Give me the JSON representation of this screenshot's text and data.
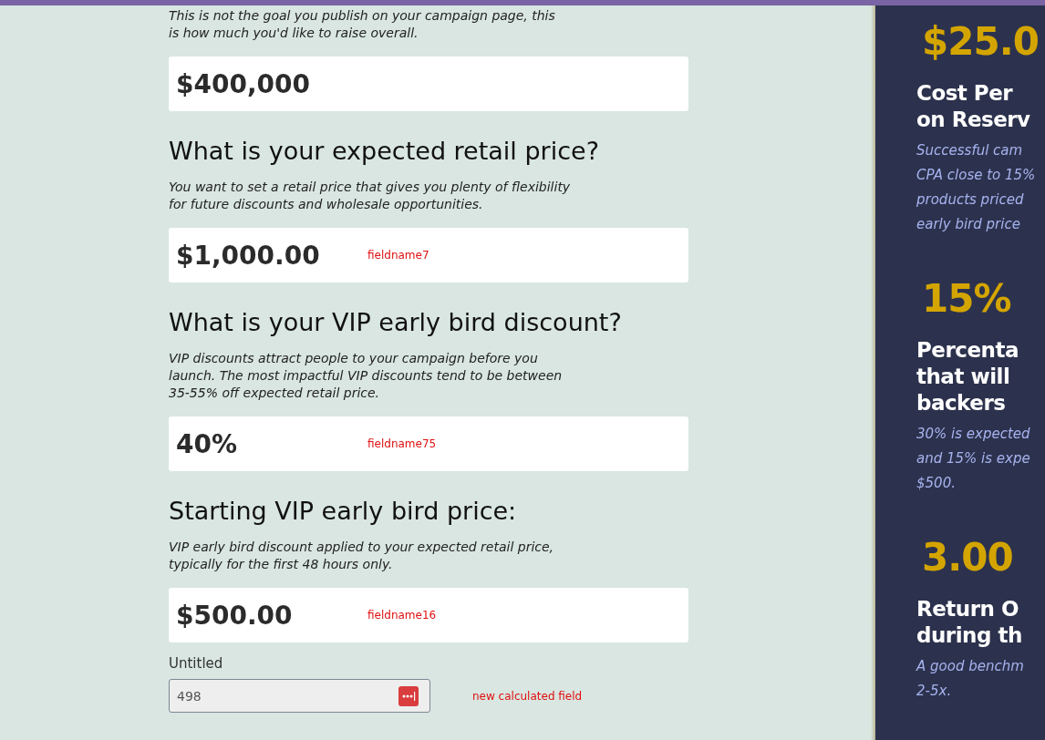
{
  "sections": [
    {
      "description": "This is not the goal you publish on your campaign page, this\nis how much you'd like to raise overall.",
      "value": "$400,000"
    },
    {
      "heading": "What is your expected retail price?",
      "description": "You want to set a retail price that gives you plenty of flexibility\nfor future discounts and wholesale opportunities.",
      "value": "$1,000.00",
      "field_tag": "fieldname7"
    },
    {
      "heading": "What is your VIP early bird discount?",
      "description": "VIP discounts attract people to your campaign before you\nlaunch. The most impactful VIP discounts tend to be between\n35-55% off expected retail price.",
      "value": "40%",
      "field_tag": "fieldname75"
    },
    {
      "heading": "Starting VIP early bird price:",
      "description": "VIP early bird discount applied to your expected retail price,\ntypically for the first 48 hours only.",
      "value": "$500.00",
      "field_tag": "fieldname16"
    }
  ],
  "calculated_field": {
    "label": "Untitled",
    "value": "498",
    "field_tag": "new calculated field"
  },
  "metrics": [
    {
      "value": "$25.0",
      "title": [
        "Cost Per",
        "on Reserv"
      ],
      "description": [
        "Successful cam",
        "CPA close to 15%",
        "products priced",
        "early bird price"
      ]
    },
    {
      "value": "15%",
      "title": [
        "Percenta",
        "that will",
        "backers"
      ],
      "description": [
        "30% is expected",
        "and 15% is expe",
        "$500."
      ]
    },
    {
      "value": "3.00",
      "title": [
        "Return O",
        "during th"
      ],
      "description": [
        "A good benchm",
        "2-5x."
      ]
    }
  ]
}
